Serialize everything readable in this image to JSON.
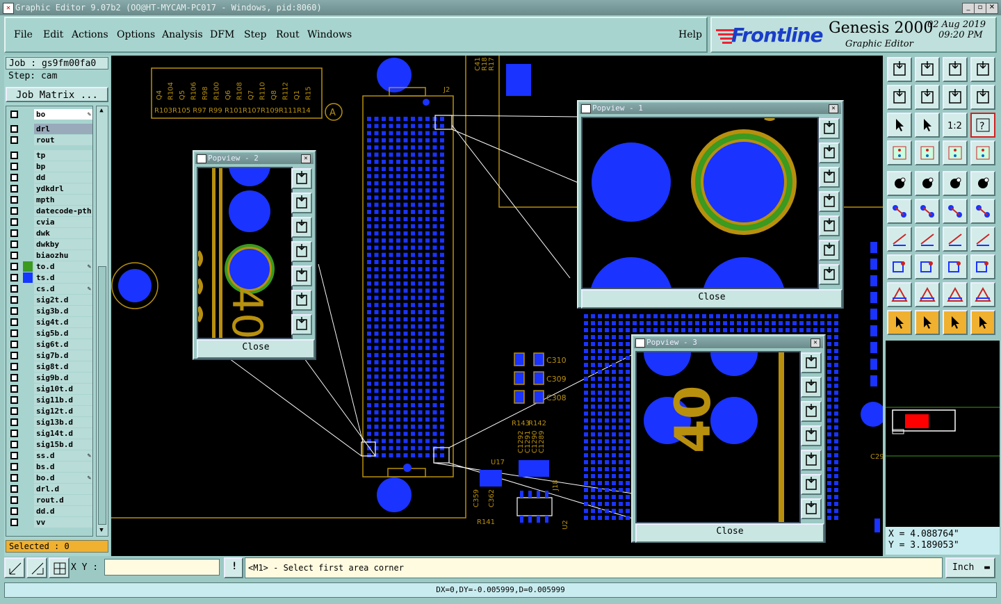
{
  "window": {
    "title": "Graphic Editor 9.07b2 (OO@HT-MYCAM-PC017 - Windows, pid:8060)"
  },
  "menu": {
    "items": [
      "File",
      "Edit",
      "Actions",
      "Options",
      "Analysis",
      "DFM",
      "Step",
      "Rout",
      "Windows"
    ],
    "help": "Help"
  },
  "brand": {
    "logo": "Frontline",
    "product": "Genesis 2000",
    "subtitle": "Graphic Editor",
    "date": "02 Aug 2019",
    "time": "09:20 PM"
  },
  "job": {
    "job_label": "Job : gs9fm00fa0",
    "step_label": "Step: cam",
    "matrix_button": "Job Matrix ..."
  },
  "layers": [
    {
      "name": "bo",
      "color": "",
      "flag": "✎"
    },
    {
      "name": "drl",
      "color": "",
      "flag": ""
    },
    {
      "name": "rout",
      "color": "",
      "flag": ""
    },
    {
      "name": "tp",
      "color": "",
      "flag": ""
    },
    {
      "name": "bp",
      "color": "",
      "flag": ""
    },
    {
      "name": "dd",
      "color": "",
      "flag": ""
    },
    {
      "name": "ydkdrl",
      "color": "",
      "flag": ""
    },
    {
      "name": "mpth",
      "color": "",
      "flag": ""
    },
    {
      "name": "datecode-pth",
      "color": "",
      "flag": ""
    },
    {
      "name": "cvia",
      "color": "",
      "flag": ""
    },
    {
      "name": "dwk",
      "color": "",
      "flag": ""
    },
    {
      "name": "dwkby",
      "color": "",
      "flag": ""
    },
    {
      "name": "biaozhu",
      "color": "",
      "flag": ""
    },
    {
      "name": "to.d",
      "color": "#3b9a1f",
      "flag": "✎"
    },
    {
      "name": "ts.d",
      "color": "#1538ff",
      "flag": ""
    },
    {
      "name": "cs.d",
      "color": "",
      "flag": "✎"
    },
    {
      "name": "sig2t.d",
      "color": "",
      "flag": ""
    },
    {
      "name": "sig3b.d",
      "color": "",
      "flag": ""
    },
    {
      "name": "sig4t.d",
      "color": "",
      "flag": ""
    },
    {
      "name": "sig5b.d",
      "color": "",
      "flag": ""
    },
    {
      "name": "sig6t.d",
      "color": "",
      "flag": ""
    },
    {
      "name": "sig7b.d",
      "color": "",
      "flag": ""
    },
    {
      "name": "sig8t.d",
      "color": "",
      "flag": ""
    },
    {
      "name": "sig9b.d",
      "color": "",
      "flag": ""
    },
    {
      "name": "sig10t.d",
      "color": "",
      "flag": ""
    },
    {
      "name": "sig11b.d",
      "color": "",
      "flag": ""
    },
    {
      "name": "sig12t.d",
      "color": "",
      "flag": ""
    },
    {
      "name": "sig13b.d",
      "color": "",
      "flag": ""
    },
    {
      "name": "sig14t.d",
      "color": "",
      "flag": ""
    },
    {
      "name": "sig15b.d",
      "color": "",
      "flag": ""
    },
    {
      "name": "ss.d",
      "color": "",
      "flag": "✎"
    },
    {
      "name": "bs.d",
      "color": "",
      "flag": ""
    },
    {
      "name": "bo.d",
      "color": "",
      "flag": "✎"
    },
    {
      "name": "drl.d",
      "color": "",
      "flag": ""
    },
    {
      "name": "rout.d",
      "color": "",
      "flag": ""
    },
    {
      "name": "dd.d",
      "color": "",
      "flag": ""
    },
    {
      "name": "vv",
      "color": "",
      "flag": ""
    }
  ],
  "selected": "Selected : 0",
  "popviews": [
    {
      "title": "Popview - 1",
      "close": "Close"
    },
    {
      "title": "Popview - 2",
      "close": "Close"
    },
    {
      "title": "Popview - 3",
      "close": "Close"
    }
  ],
  "pcb_labels": {
    "resistors_top": [
      "Q4",
      "R104",
      "Q5",
      "R106",
      "R98",
      "R100",
      "Q6",
      "R108",
      "Q7",
      "R110",
      "Q8",
      "R112",
      "Q1",
      "R15"
    ],
    "resistors_bottom": "R103R105 R97 R99 R101R107R109R111R14",
    "marker": "A",
    "caps": [
      "C310",
      "C309",
      "C308"
    ],
    "other": [
      "C41",
      "R18",
      "R17",
      "J2",
      "R143",
      "R142",
      "C1292",
      "C1291",
      "C1290",
      "C1289",
      "U17",
      "J18",
      "C359",
      "C362",
      "R141",
      "U2",
      "C29"
    ]
  },
  "coords": {
    "x": "X = 4.088764\"",
    "y": "Y = 3.189053\""
  },
  "command": {
    "xy_label": "X Y :",
    "xy_value": "",
    "prompt": "<M1> - Select first area corner",
    "unit": "Inch"
  },
  "status": "DX=0,DY=-0.005999,D=0.005999",
  "colors": {
    "pad": "#1a33ff",
    "trace": "#b8900e",
    "ring": "#3b9a1f",
    "bg": "#000000"
  }
}
